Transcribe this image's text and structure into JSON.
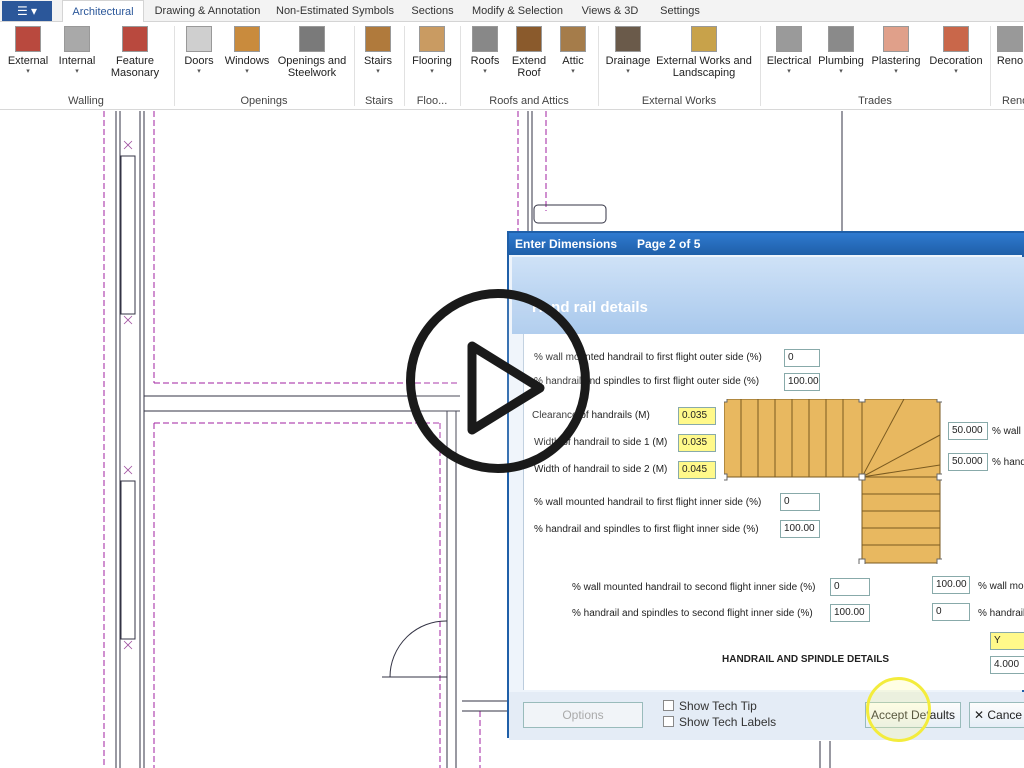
{
  "app_button": "☰ ▾",
  "tabs": [
    "Architectural",
    "Drawing & Annotation",
    "Non-Estimated Symbols",
    "Sections",
    "Modify & Selection",
    "Views & 3D",
    "Settings"
  ],
  "ribbon": {
    "buttons": [
      {
        "label": "External",
        "color": "#b9493e"
      },
      {
        "label": "Internal",
        "color": "#a9a9a9"
      },
      {
        "label": "Feature Masonary",
        "color": "#b9493e"
      },
      {
        "label": "Doors",
        "color": "#cfcfcf"
      },
      {
        "label": "Windows",
        "color": "#c98b3d"
      },
      {
        "label": "Openings and Steelwork",
        "color": "#7a7a7a"
      },
      {
        "label": "Stairs",
        "color": "#b07a3c"
      },
      {
        "label": "Flooring",
        "color": "#c99b62"
      },
      {
        "label": "Roofs",
        "color": "#888888"
      },
      {
        "label": "Extend Roof",
        "color": "#8a5a2c"
      },
      {
        "label": "Attic",
        "color": "#a57c4a"
      },
      {
        "label": "Drainage",
        "color": "#6a5a4a"
      },
      {
        "label": "External Works and Landscaping",
        "color": "#c8a24a"
      },
      {
        "label": "Electrical",
        "color": "#9a9a9a"
      },
      {
        "label": "Plumbing",
        "color": "#8a8a8a"
      },
      {
        "label": "Plastering",
        "color": "#e0a08a"
      },
      {
        "label": "Decoration",
        "color": "#c9674a"
      },
      {
        "label": "Reno",
        "color": "#999999"
      }
    ],
    "groups": [
      "Walling",
      "Openings",
      "Stairs",
      "Floo...",
      "Roofs and Attics",
      "External Works",
      "Trades",
      "Reno"
    ]
  },
  "dialog": {
    "title": "Enter Dimensions",
    "page": "Page 2 of 5",
    "heading": "Hand rail details",
    "rows_left": [
      {
        "label": "% wall mounted handrail to first flight outer side (%)",
        "value": "0"
      },
      {
        "label": "% handrail and spindles to first flight outer side (%)",
        "value": "100.00"
      },
      {
        "label": "Clearance of handrails (M)",
        "value": "0.035"
      },
      {
        "label": "Width of handrail to side 1 (M)",
        "value": "0.035"
      },
      {
        "label": "Width of handrail to side 2 (M)",
        "value": "0.045"
      },
      {
        "label": "% wall mounted handrail to first flight inner side (%)",
        "value": "0"
      },
      {
        "label": "% handrail and spindles to first flight inner side (%)",
        "value": "100.00"
      },
      {
        "label": "% wall mounted handrail to second flight inner side (%)",
        "value": "0"
      },
      {
        "label": "% handrail and spindles to second flight inner side (%)",
        "value": "100.00"
      }
    ],
    "rows_right": [
      {
        "value": "50.000",
        "label": "% wall m"
      },
      {
        "value": "50.000",
        "label": "% handr"
      },
      {
        "value": "100.00",
        "label": "% wall mou"
      },
      {
        "value": "0",
        "label": "% handrail"
      },
      {
        "value": "Y",
        "label": ""
      },
      {
        "value": "4.000",
        "label": ""
      }
    ],
    "section_label": "HANDRAIL AND SPINDLE DETAILS",
    "footer": {
      "options": "Options",
      "show_tech_tip": "Show Tech Tip",
      "show_tech_labels": "Show Tech Labels",
      "accept": "Accept Defaults",
      "cancel": "✕ Cance"
    }
  },
  "colors": {
    "accent": "#2b579a",
    "dialog_border": "#1f5fa8",
    "field_highlight": "#fff98a",
    "wall_line": "#a020a0"
  }
}
